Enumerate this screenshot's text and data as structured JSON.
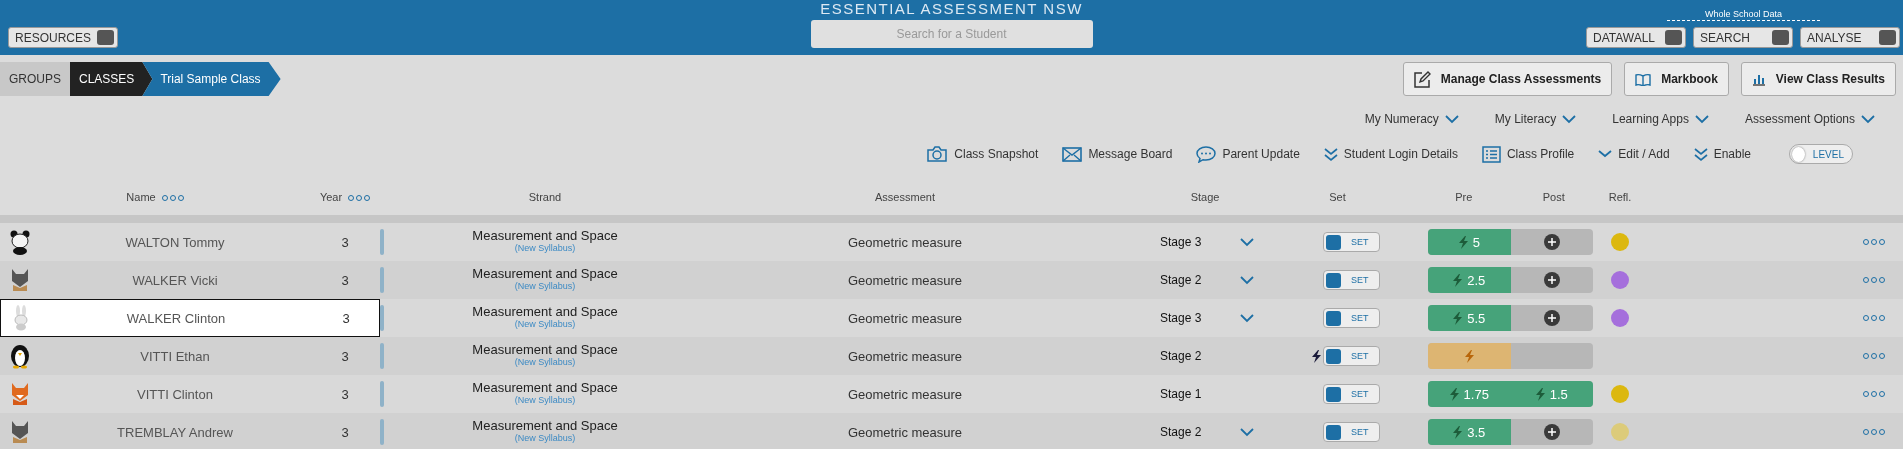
{
  "header": {
    "title": "ESSENTIAL ASSESSMENT NSW",
    "resources_button": "RESOURCES",
    "search": {
      "placeholder": "Search for a Student"
    },
    "school_data_label": "Whole School Data",
    "school_buttons": [
      "DATAWALL",
      "SEARCH",
      "ANALYSE"
    ]
  },
  "breadcrumb": [
    {
      "label": "GROUPS",
      "kind": "plain"
    },
    {
      "label": "CLASSES",
      "kind": "dark"
    },
    {
      "label": "Trial Sample Class",
      "kind": "current"
    }
  ],
  "class_buttons": [
    {
      "label": "Manage Class Assessments",
      "kind": "edit"
    },
    {
      "label": "Markbook",
      "kind": "book"
    },
    {
      "label": "View Class Results",
      "kind": "chart"
    }
  ],
  "menus": [
    "My Numeracy",
    "My Literacy",
    "Learning Apps",
    "Assessment Options"
  ],
  "actions": [
    {
      "label": "Class Snapshot",
      "kind": "camera"
    },
    {
      "label": "Message Board",
      "kind": "envelope"
    },
    {
      "label": "Parent Update",
      "kind": "bubble"
    },
    {
      "label": "Student Login Details",
      "kind": "double"
    },
    {
      "label": "Class Profile",
      "kind": "list"
    },
    {
      "label": "Edit / Add",
      "kind": "chevron"
    },
    {
      "label": "Enable",
      "kind": "double"
    }
  ],
  "level_toggle": {
    "label": "LEVEL",
    "on": false
  },
  "table": {
    "columns": [
      "Name",
      "Year",
      "Strand",
      "Assessment",
      "Stage",
      "Set",
      "Pre",
      "Post",
      "Refl."
    ],
    "rows": [
      {
        "avatar": {
          "kind": "panda"
        },
        "name": "WALTON Tommy",
        "year": "3",
        "strand": "Measurement and Space",
        "strand_note": "(New Syllabus)",
        "assessment": "Geometric measure",
        "stage": "Stage 3",
        "stage_menu": true,
        "flagged": false,
        "set": "SET",
        "pre": {
          "kind": "done",
          "value": "5"
        },
        "post": {
          "kind": "add"
        },
        "color": "#dcb80f",
        "selected": false
      },
      {
        "avatar": {
          "kind": "wolf"
        },
        "name": "WALKER Vicki",
        "year": "3",
        "strand": "Measurement and Space",
        "strand_note": "(New Syllabus)",
        "assessment": "Geometric measure",
        "stage": "Stage 2",
        "stage_menu": true,
        "flagged": false,
        "set": "SET",
        "pre": {
          "kind": "done",
          "value": "2.5"
        },
        "post": {
          "kind": "add"
        },
        "color": "#a56fdc",
        "selected": false
      },
      {
        "avatar": {
          "kind": "rabbit"
        },
        "name": "WALKER Clinton",
        "year": "3",
        "strand": "Measurement and Space",
        "strand_note": "(New Syllabus)",
        "assessment": "Geometric measure",
        "stage": "Stage 3",
        "stage_menu": true,
        "flagged": false,
        "set": "SET",
        "pre": {
          "kind": "done",
          "value": "5.5"
        },
        "post": {
          "kind": "add"
        },
        "color": "#a56fdc",
        "selected": true
      },
      {
        "avatar": {
          "kind": "penguin"
        },
        "name": "VITTI Ethan",
        "year": "3",
        "strand": "Measurement and Space",
        "strand_note": "(New Syllabus)",
        "assessment": "Geometric measure",
        "stage": "Stage 2",
        "stage_menu": false,
        "flagged": true,
        "set": "SET",
        "pre": {
          "kind": "pending"
        },
        "post": {
          "kind": "empty"
        },
        "selected": false
      },
      {
        "avatar": {
          "kind": "fox"
        },
        "name": "VITTI Clinton",
        "year": "3",
        "strand": "Measurement and Space",
        "strand_note": "(New Syllabus)",
        "assessment": "Geometric measure",
        "stage": "Stage 1",
        "stage_menu": false,
        "flagged": false,
        "set": "SET",
        "pre": {
          "kind": "done",
          "value": "1.75"
        },
        "post": {
          "kind": "done",
          "value": "1.5"
        },
        "color": "#dcb80f",
        "selected": false
      },
      {
        "avatar": {
          "kind": "wolf"
        },
        "name": "TREMBLAY Andrew",
        "year": "3",
        "strand": "Measurement and Space",
        "strand_note": "(New Syllabus)",
        "assessment": "Geometric measure",
        "stage": "Stage 2",
        "stage_menu": true,
        "flagged": false,
        "set": "SET",
        "pre": {
          "kind": "done",
          "value": "3.5"
        },
        "post": {
          "kind": "add"
        },
        "color": "#dccb7a",
        "selected": false
      }
    ]
  }
}
